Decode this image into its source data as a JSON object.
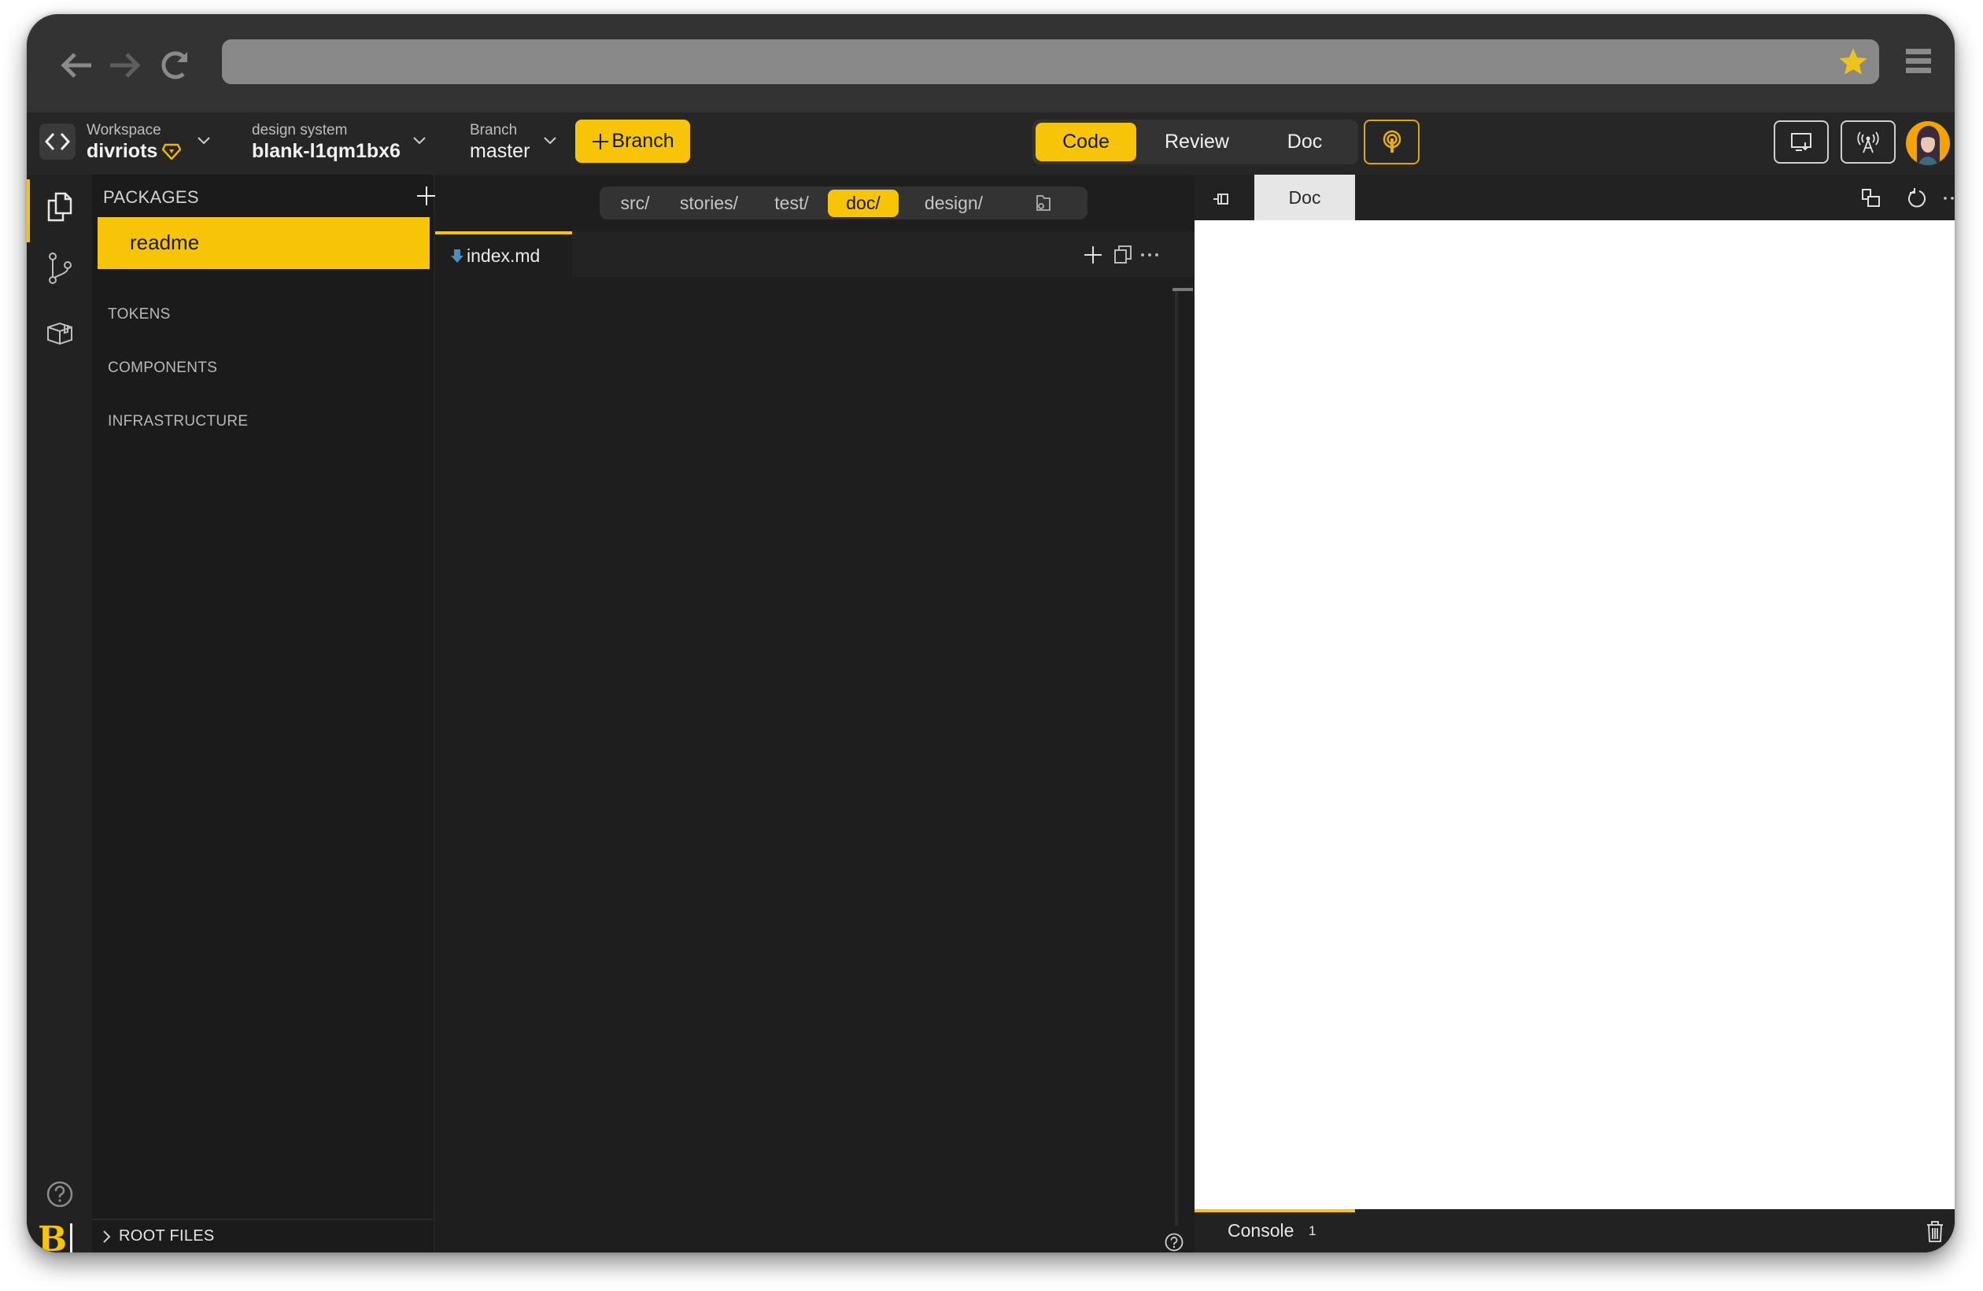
{
  "browser": {
    "address_value": "",
    "icons": [
      "back-arrow-icon",
      "forward-arrow-icon",
      "reload-icon",
      "bookmark-star-icon",
      "hamburger-menu-icon"
    ]
  },
  "header": {
    "workspace": {
      "label": "Workspace",
      "value": "divriots"
    },
    "project": {
      "label": "design system",
      "value": "blank-l1qm1bx6"
    },
    "branch": {
      "label": "Branch",
      "value": "master"
    },
    "new_branch_label": "Branch",
    "modes": [
      {
        "label": "Code",
        "active": true
      },
      {
        "label": "Review",
        "active": false
      },
      {
        "label": "Doc",
        "active": false
      }
    ]
  },
  "sidebar": {
    "title": "PACKAGES",
    "selected_item": "readme",
    "sections": [
      "TOKENS",
      "COMPONENTS",
      "INFRASTRUCTURE"
    ],
    "footer": "ROOT FILES"
  },
  "editor": {
    "folders": [
      {
        "label": "src/",
        "active": false
      },
      {
        "label": "stories/",
        "active": false
      },
      {
        "label": "test/",
        "active": false
      },
      {
        "label": "doc/",
        "active": true
      },
      {
        "label": "design/",
        "active": false
      }
    ],
    "open_tab": "index.md"
  },
  "preview": {
    "tab": "Doc",
    "console_label": "Console",
    "console_count": "1"
  },
  "colors": {
    "accent": "#f7c407",
    "chrome": "#333333",
    "header": "#262626",
    "sidebar": "#1b1b1b",
    "editor": "#1e1e1e",
    "file_icon": "#4a90b8"
  }
}
